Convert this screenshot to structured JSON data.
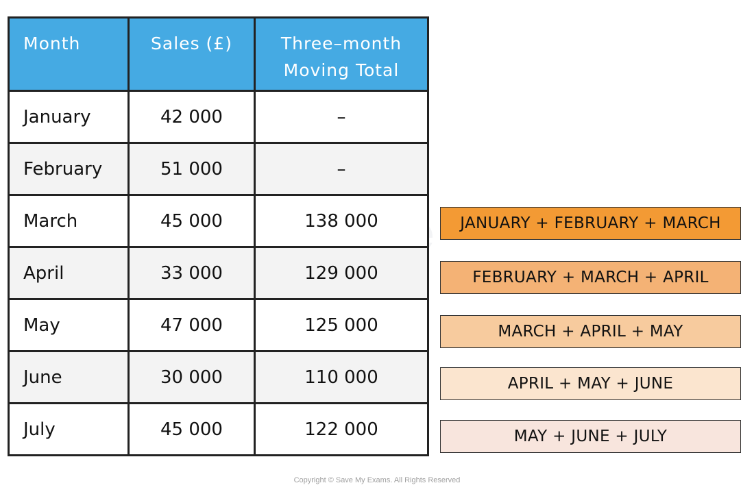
{
  "table": {
    "headers": [
      "Month",
      "Sales (£)",
      "Three–month Moving Total"
    ],
    "header_lines": {
      "col3_line1": "Three–month",
      "col3_line2": "Moving Total"
    },
    "rows": [
      {
        "month": "January",
        "sales": "42 000",
        "moving_total": "–"
      },
      {
        "month": "February",
        "sales": "51 000",
        "moving_total": "–"
      },
      {
        "month": "March",
        "sales": "45 000",
        "moving_total": "138 000"
      },
      {
        "month": "April",
        "sales": "33 000",
        "moving_total": "129 000"
      },
      {
        "month": "May",
        "sales": "47 000",
        "moving_total": "125 000"
      },
      {
        "month": "June",
        "sales": "30 000",
        "moving_total": "110 000"
      },
      {
        "month": "July",
        "sales": "45 000",
        "moving_total": "122 000"
      }
    ],
    "header_color": "#45aae3"
  },
  "sum_labels": [
    {
      "text": "JANUARY + FEBRUARY + MARCH",
      "color": "#f39a34"
    },
    {
      "text": "FEBRUARY + MARCH + APRIL",
      "color": "#f4b275"
    },
    {
      "text": "MARCH + APRIL + MAY",
      "color": "#f7cb9e"
    },
    {
      "text": "APRIL + MAY + JUNE",
      "color": "#fbe5cf"
    },
    {
      "text": "MAY + JUNE + JULY",
      "color": "#f8e5dd"
    }
  ],
  "watermark": "Save My Exams",
  "copyright": "Copyright © Save My Exams. All Rights Reserved"
}
